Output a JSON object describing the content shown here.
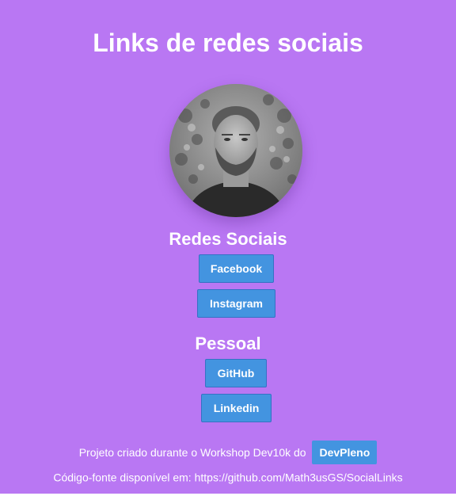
{
  "page": {
    "title": "Links de redes sociais"
  },
  "profile": {
    "avatar_alt": "profile-photo"
  },
  "social": {
    "heading": "Redes Sociais",
    "links": [
      {
        "label": "Facebook"
      },
      {
        "label": "Instagram"
      }
    ]
  },
  "personal": {
    "heading": "Pessoal",
    "links": [
      {
        "label": "GitHub"
      },
      {
        "label": "Linkedin"
      }
    ]
  },
  "footer": {
    "project_text": "Projeto criado durante o Workshop Dev10k do",
    "brand_label": "DevPleno",
    "source_text": "Código-fonte disponível em: https://github.com/Math3usGS/SocialLinks"
  },
  "colors": {
    "background": "#b977f3",
    "button": "#4394e0",
    "text": "#ffffff"
  }
}
